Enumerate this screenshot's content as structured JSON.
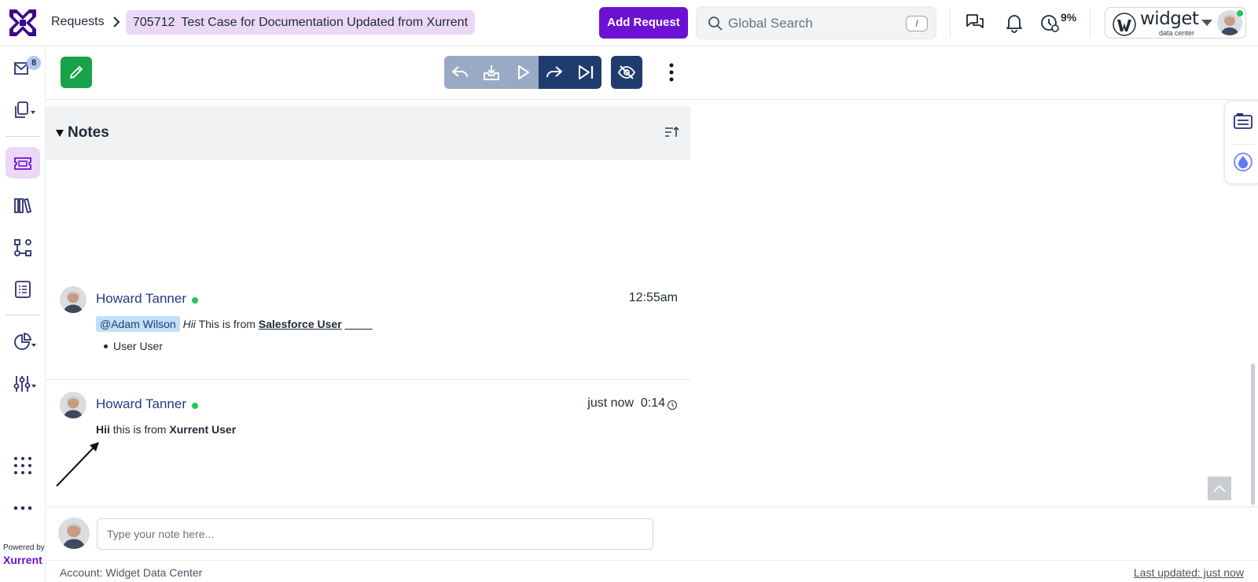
{
  "header": {
    "breadcrumb_root": "Requests",
    "request_id": "705712",
    "request_title": "Test Case for Documentation Updated from Xurrent",
    "add_request_label": "Add Request",
    "search_placeholder": "Global Search",
    "search_shortcut": "/",
    "timer_percent": "9%",
    "org_name": "widget",
    "org_subtitle": "data center"
  },
  "leftnav": {
    "inbox_badge": "8",
    "powered_by": "Powered by",
    "brand": "Xurrent"
  },
  "notes": {
    "section_title": "Notes",
    "items": [
      {
        "author": "Howard Tanner",
        "time": "12:55am",
        "mention": "@Adam Wilson",
        "italic_word": "Hii",
        "text": "This is from",
        "bold_underlined": "Salesforce User",
        "trailing": "__ __",
        "bullet": "User User"
      },
      {
        "author": "Howard Tanner",
        "time": "just now",
        "timer": "0:14",
        "bold_start": "Hii",
        "text": "this is from",
        "bold_end": "Xurrent User"
      }
    ]
  },
  "composer": {
    "placeholder": "Type your note here..."
  },
  "footer": {
    "account": "Account: Widget Data Center",
    "last_updated": "Last updated: just now"
  },
  "colors": {
    "brand_purple": "#6d11d4",
    "highlight_lilac": "#ecd8f6",
    "navy": "#1f3c6e",
    "author_blue": "#213b86",
    "online_green": "#22c55e",
    "edit_green": "#16a34a"
  }
}
